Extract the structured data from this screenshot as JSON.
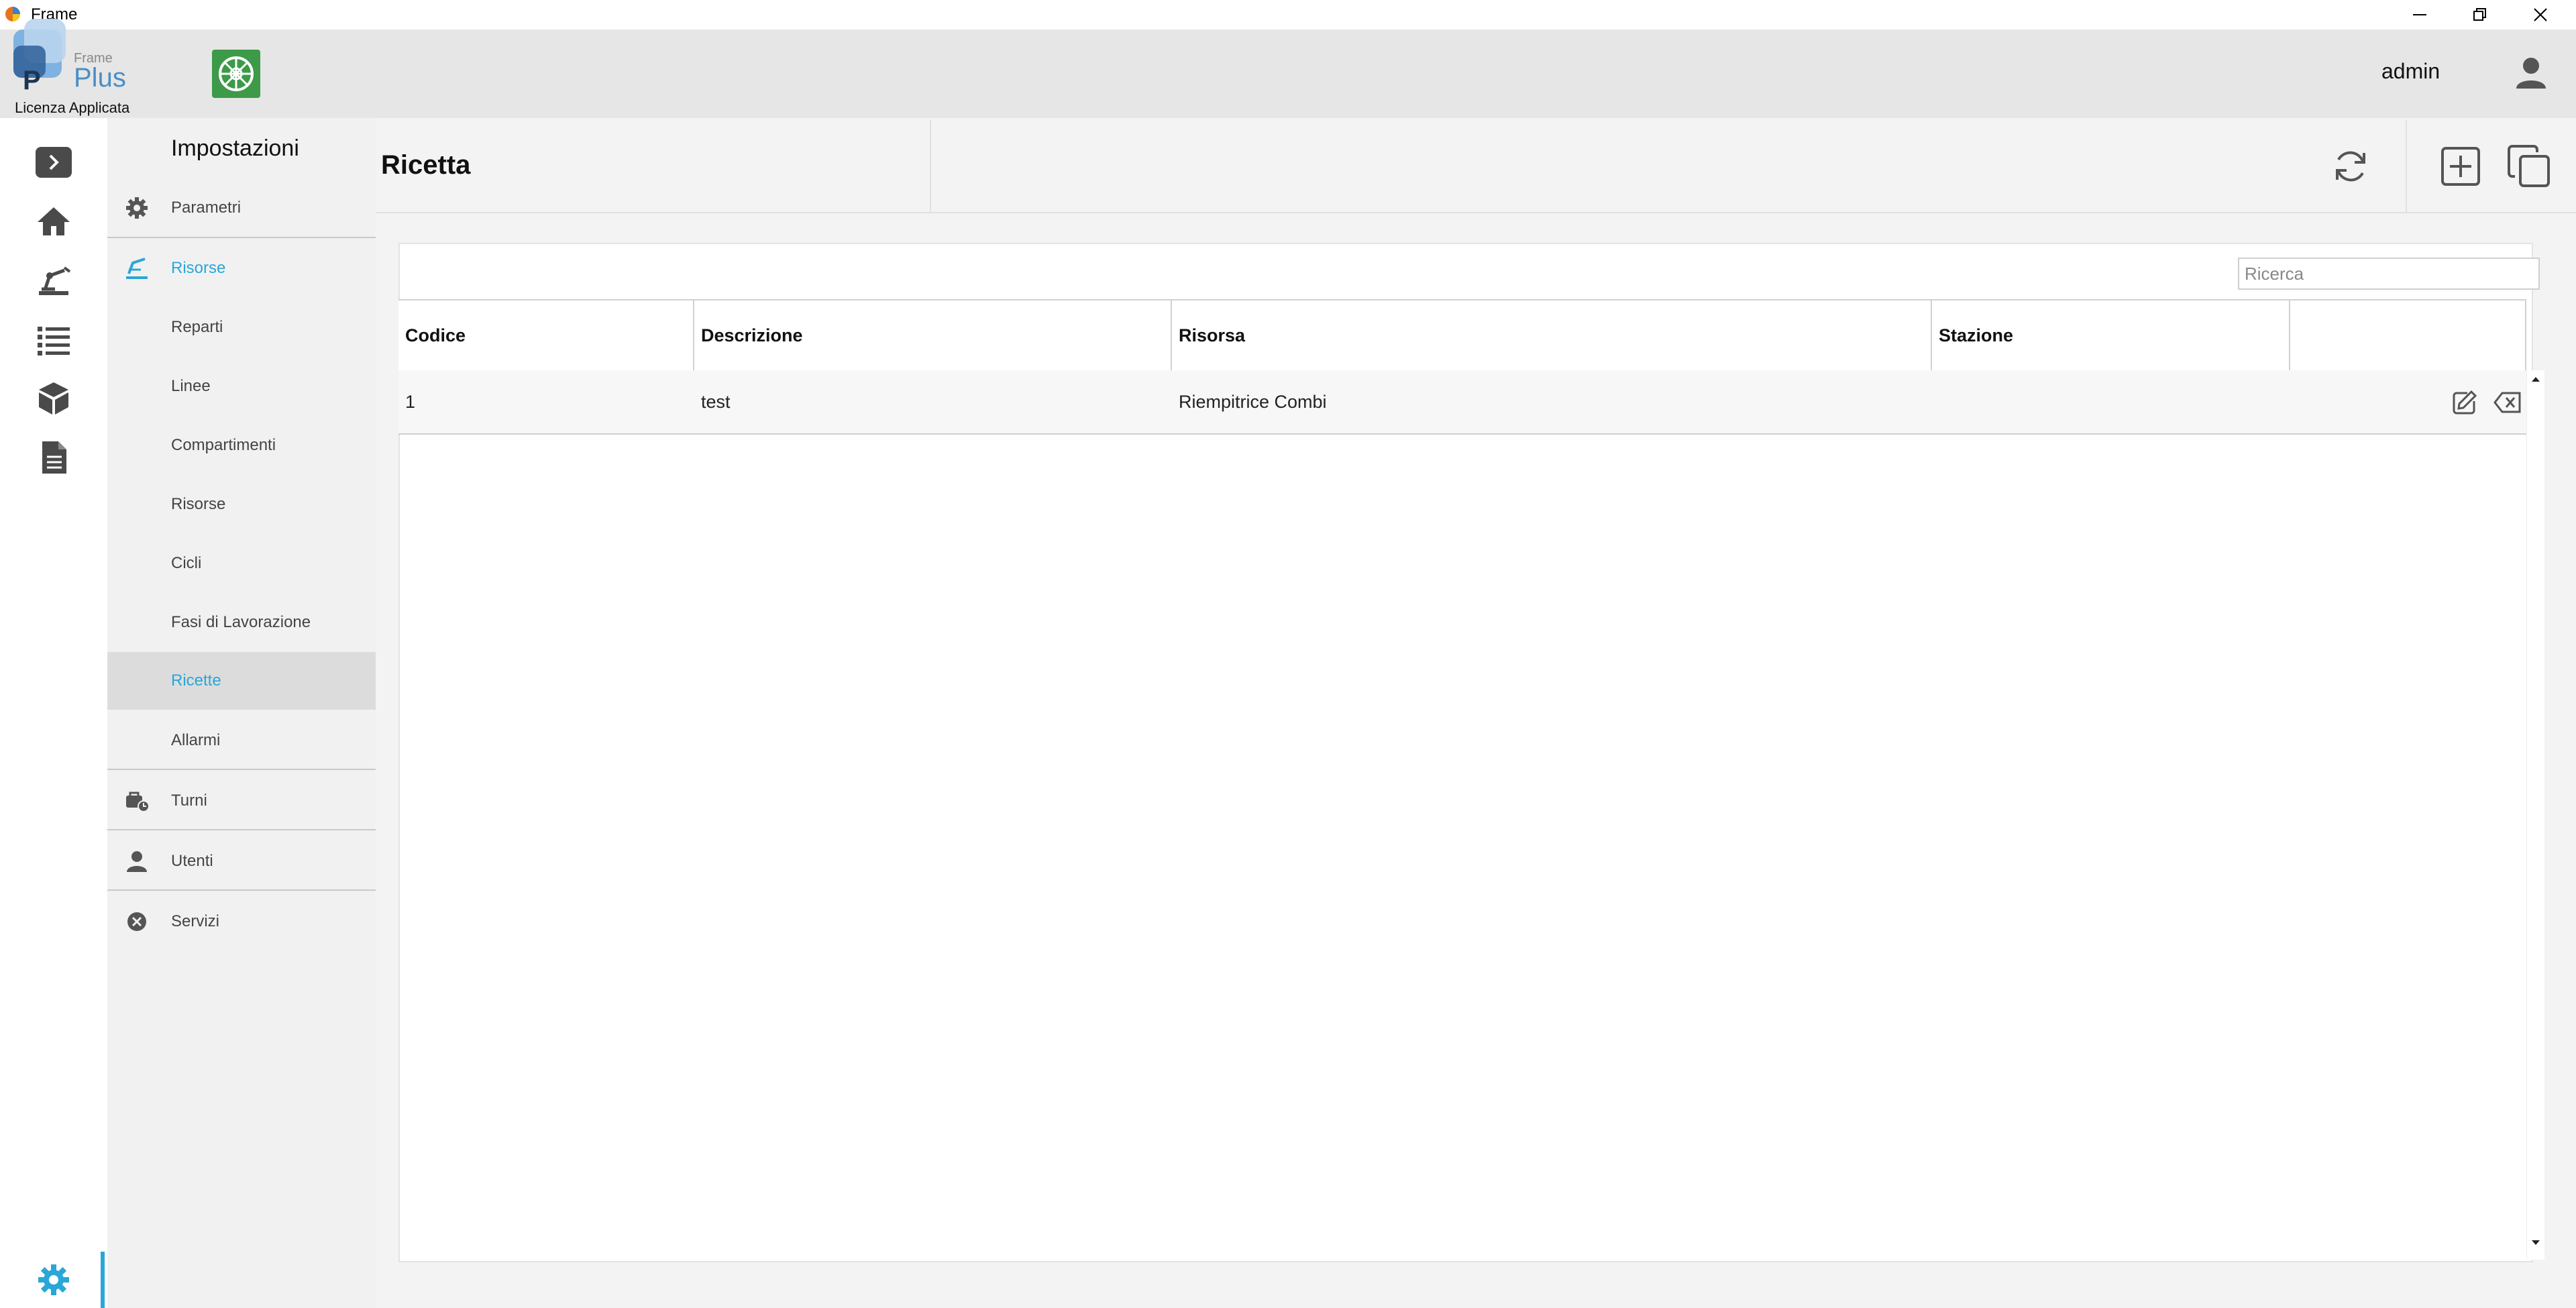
{
  "window": {
    "title": "Frame"
  },
  "header": {
    "brand_top": "Frame",
    "brand_name": "Plus",
    "brand_letter": "P",
    "license": "Licenza Applicata",
    "user": "admin"
  },
  "sidebar": {
    "title": "Impostazioni",
    "items": [
      {
        "label": "Parametri"
      },
      {
        "label": "Risorse"
      },
      {
        "label": "Reparti"
      },
      {
        "label": "Linee"
      },
      {
        "label": "Compartimenti"
      },
      {
        "label": "Risorse"
      },
      {
        "label": "Cicli"
      },
      {
        "label": "Fasi di Lavorazione"
      },
      {
        "label": "Ricette"
      },
      {
        "label": "Allarmi"
      },
      {
        "label": "Turni"
      },
      {
        "label": "Utenti"
      },
      {
        "label": "Servizi"
      }
    ]
  },
  "content": {
    "title": "Ricetta",
    "search_placeholder": "Ricerca",
    "columns": [
      "Codice",
      "Descrizione",
      "Risorsa",
      "Stazione"
    ],
    "rows": [
      {
        "codice": "1",
        "descrizione": "test",
        "risorsa": "Riempitrice Combi",
        "stazione": ""
      }
    ]
  },
  "colors": {
    "accent": "#2aa6d8",
    "brand_blue": "#4a8ec8",
    "logo_green": "#3d9a48"
  }
}
